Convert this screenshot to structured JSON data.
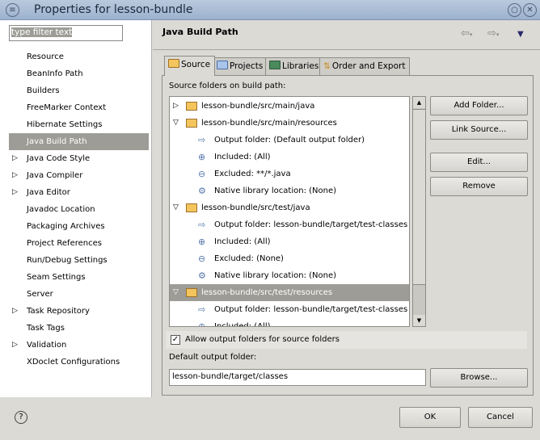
{
  "window": {
    "title": "Properties for lesson-bundle",
    "menu_icon": "window-menu-icon",
    "maximize_icon": "maximize-icon",
    "close_icon": "close-icon"
  },
  "filter": {
    "placeholder": "type filter text"
  },
  "nav": [
    {
      "label": "Resource",
      "expandable": false
    },
    {
      "label": "BeanInfo Path",
      "expandable": false
    },
    {
      "label": "Builders",
      "expandable": false
    },
    {
      "label": "FreeMarker Context",
      "expandable": false
    },
    {
      "label": "Hibernate Settings",
      "expandable": false
    },
    {
      "label": "Java Build Path",
      "expandable": false,
      "selected": true
    },
    {
      "label": "Java Code Style",
      "expandable": true
    },
    {
      "label": "Java Compiler",
      "expandable": true
    },
    {
      "label": "Java Editor",
      "expandable": true
    },
    {
      "label": "Javadoc Location",
      "expandable": false
    },
    {
      "label": "Packaging Archives",
      "expandable": false
    },
    {
      "label": "Project References",
      "expandable": false
    },
    {
      "label": "Run/Debug Settings",
      "expandable": false
    },
    {
      "label": "Seam Settings",
      "expandable": false
    },
    {
      "label": "Server",
      "expandable": false
    },
    {
      "label": "Task Repository",
      "expandable": true
    },
    {
      "label": "Task Tags",
      "expandable": false
    },
    {
      "label": "Validation",
      "expandable": true
    },
    {
      "label": "XDoclet Configurations",
      "expandable": false
    }
  ],
  "page": {
    "title": "Java Build Path"
  },
  "tabs": [
    {
      "label": "Source"
    },
    {
      "label": "Projects"
    },
    {
      "label": "Libraries"
    },
    {
      "label": "Order and Export"
    }
  ],
  "source": {
    "label": "Source folders on build path:",
    "tree": [
      {
        "text": "lesson-bundle/src/main/java",
        "level": 0,
        "toggle": "collapsed"
      },
      {
        "text": "lesson-bundle/src/main/resources",
        "level": 0,
        "toggle": "expanded"
      },
      {
        "text": "Output folder: (Default output folder)",
        "level": 1,
        "icon": "output-folder"
      },
      {
        "text": "Included: (All)",
        "level": 1,
        "icon": "included"
      },
      {
        "text": "Excluded: **/*.java",
        "level": 1,
        "icon": "excluded"
      },
      {
        "text": "Native library location: (None)",
        "level": 1,
        "icon": "native-lib"
      },
      {
        "text": "lesson-bundle/src/test/java",
        "level": 0,
        "toggle": "expanded"
      },
      {
        "text": "Output folder: lesson-bundle/target/test-classes",
        "level": 1,
        "icon": "output-folder"
      },
      {
        "text": "Included: (All)",
        "level": 1,
        "icon": "included"
      },
      {
        "text": "Excluded: (None)",
        "level": 1,
        "icon": "excluded"
      },
      {
        "text": "Native library location: (None)",
        "level": 1,
        "icon": "native-lib"
      },
      {
        "text": "lesson-bundle/src/test/resources",
        "level": 0,
        "toggle": "expanded",
        "selected": true
      },
      {
        "text": "Output folder: lesson-bundle/target/test-classes",
        "level": 1,
        "icon": "output-folder"
      },
      {
        "text": "Included: (All)",
        "level": 1,
        "icon": "included"
      }
    ],
    "buttons": {
      "add_folder": "Add Folder...",
      "link_source": "Link Source...",
      "edit": "Edit...",
      "remove": "Remove"
    },
    "allow_output_label": "Allow output folders for source folders",
    "allow_output_checked": true,
    "default_output_label": "Default output folder:",
    "default_output_value": "lesson-bundle/target/classes",
    "browse": "Browse..."
  },
  "footer": {
    "ok": "OK",
    "cancel": "Cancel"
  }
}
